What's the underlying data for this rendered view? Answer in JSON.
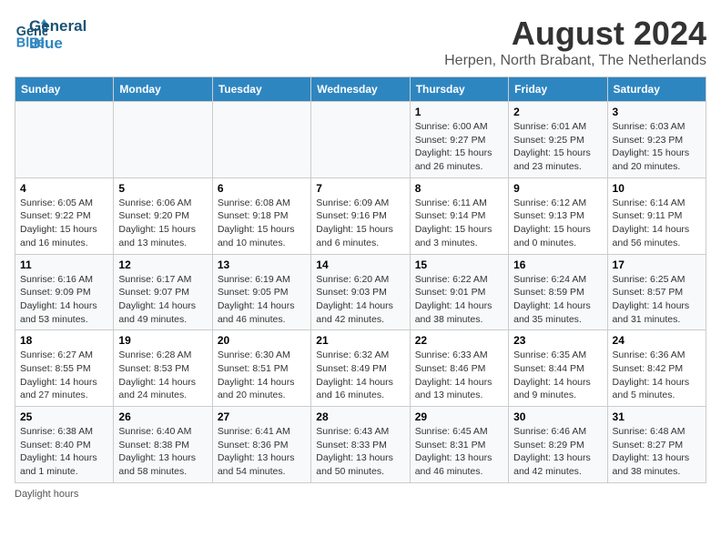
{
  "logo": {
    "line1": "General",
    "line2": "Blue"
  },
  "title": "August 2024",
  "location": "Herpen, North Brabant, The Netherlands",
  "days_header": [
    "Sunday",
    "Monday",
    "Tuesday",
    "Wednesday",
    "Thursday",
    "Friday",
    "Saturday"
  ],
  "weeks": [
    [
      {
        "num": "",
        "info": ""
      },
      {
        "num": "",
        "info": ""
      },
      {
        "num": "",
        "info": ""
      },
      {
        "num": "",
        "info": ""
      },
      {
        "num": "1",
        "info": "Sunrise: 6:00 AM\nSunset: 9:27 PM\nDaylight: 15 hours and 26 minutes."
      },
      {
        "num": "2",
        "info": "Sunrise: 6:01 AM\nSunset: 9:25 PM\nDaylight: 15 hours and 23 minutes."
      },
      {
        "num": "3",
        "info": "Sunrise: 6:03 AM\nSunset: 9:23 PM\nDaylight: 15 hours and 20 minutes."
      }
    ],
    [
      {
        "num": "4",
        "info": "Sunrise: 6:05 AM\nSunset: 9:22 PM\nDaylight: 15 hours and 16 minutes."
      },
      {
        "num": "5",
        "info": "Sunrise: 6:06 AM\nSunset: 9:20 PM\nDaylight: 15 hours and 13 minutes."
      },
      {
        "num": "6",
        "info": "Sunrise: 6:08 AM\nSunset: 9:18 PM\nDaylight: 15 hours and 10 minutes."
      },
      {
        "num": "7",
        "info": "Sunrise: 6:09 AM\nSunset: 9:16 PM\nDaylight: 15 hours and 6 minutes."
      },
      {
        "num": "8",
        "info": "Sunrise: 6:11 AM\nSunset: 9:14 PM\nDaylight: 15 hours and 3 minutes."
      },
      {
        "num": "9",
        "info": "Sunrise: 6:12 AM\nSunset: 9:13 PM\nDaylight: 15 hours and 0 minutes."
      },
      {
        "num": "10",
        "info": "Sunrise: 6:14 AM\nSunset: 9:11 PM\nDaylight: 14 hours and 56 minutes."
      }
    ],
    [
      {
        "num": "11",
        "info": "Sunrise: 6:16 AM\nSunset: 9:09 PM\nDaylight: 14 hours and 53 minutes."
      },
      {
        "num": "12",
        "info": "Sunrise: 6:17 AM\nSunset: 9:07 PM\nDaylight: 14 hours and 49 minutes."
      },
      {
        "num": "13",
        "info": "Sunrise: 6:19 AM\nSunset: 9:05 PM\nDaylight: 14 hours and 46 minutes."
      },
      {
        "num": "14",
        "info": "Sunrise: 6:20 AM\nSunset: 9:03 PM\nDaylight: 14 hours and 42 minutes."
      },
      {
        "num": "15",
        "info": "Sunrise: 6:22 AM\nSunset: 9:01 PM\nDaylight: 14 hours and 38 minutes."
      },
      {
        "num": "16",
        "info": "Sunrise: 6:24 AM\nSunset: 8:59 PM\nDaylight: 14 hours and 35 minutes."
      },
      {
        "num": "17",
        "info": "Sunrise: 6:25 AM\nSunset: 8:57 PM\nDaylight: 14 hours and 31 minutes."
      }
    ],
    [
      {
        "num": "18",
        "info": "Sunrise: 6:27 AM\nSunset: 8:55 PM\nDaylight: 14 hours and 27 minutes."
      },
      {
        "num": "19",
        "info": "Sunrise: 6:28 AM\nSunset: 8:53 PM\nDaylight: 14 hours and 24 minutes."
      },
      {
        "num": "20",
        "info": "Sunrise: 6:30 AM\nSunset: 8:51 PM\nDaylight: 14 hours and 20 minutes."
      },
      {
        "num": "21",
        "info": "Sunrise: 6:32 AM\nSunset: 8:49 PM\nDaylight: 14 hours and 16 minutes."
      },
      {
        "num": "22",
        "info": "Sunrise: 6:33 AM\nSunset: 8:46 PM\nDaylight: 14 hours and 13 minutes."
      },
      {
        "num": "23",
        "info": "Sunrise: 6:35 AM\nSunset: 8:44 PM\nDaylight: 14 hours and 9 minutes."
      },
      {
        "num": "24",
        "info": "Sunrise: 6:36 AM\nSunset: 8:42 PM\nDaylight: 14 hours and 5 minutes."
      }
    ],
    [
      {
        "num": "25",
        "info": "Sunrise: 6:38 AM\nSunset: 8:40 PM\nDaylight: 14 hours and 1 minute."
      },
      {
        "num": "26",
        "info": "Sunrise: 6:40 AM\nSunset: 8:38 PM\nDaylight: 13 hours and 58 minutes."
      },
      {
        "num": "27",
        "info": "Sunrise: 6:41 AM\nSunset: 8:36 PM\nDaylight: 13 hours and 54 minutes."
      },
      {
        "num": "28",
        "info": "Sunrise: 6:43 AM\nSunset: 8:33 PM\nDaylight: 13 hours and 50 minutes."
      },
      {
        "num": "29",
        "info": "Sunrise: 6:45 AM\nSunset: 8:31 PM\nDaylight: 13 hours and 46 minutes."
      },
      {
        "num": "30",
        "info": "Sunrise: 6:46 AM\nSunset: 8:29 PM\nDaylight: 13 hours and 42 minutes."
      },
      {
        "num": "31",
        "info": "Sunrise: 6:48 AM\nSunset: 8:27 PM\nDaylight: 13 hours and 38 minutes."
      }
    ]
  ],
  "footer": "Daylight hours"
}
